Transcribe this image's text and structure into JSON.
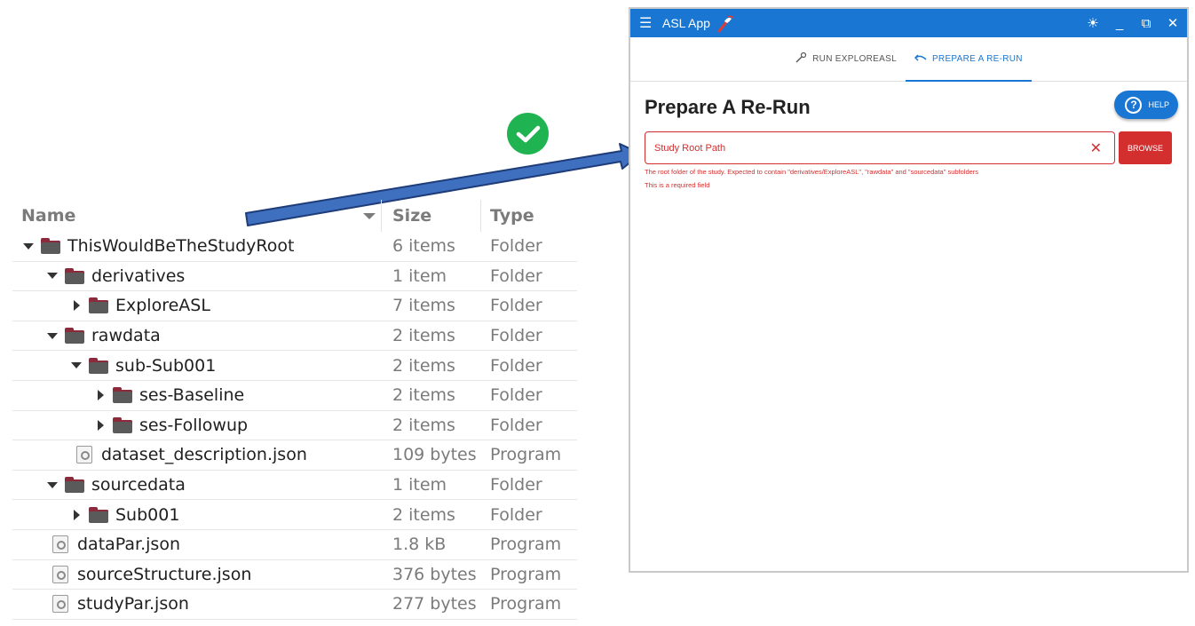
{
  "tree": {
    "header": {
      "name": "Name",
      "size": "Size",
      "type": "Type"
    },
    "rows": [
      {
        "name": "ThisWouldBeTheStudyRoot",
        "size": "6 items",
        "type": "Folder",
        "kind": "folder",
        "depth": 0,
        "expander": "down"
      },
      {
        "name": "derivatives",
        "size": "1 item",
        "type": "Folder",
        "kind": "folder",
        "depth": 1,
        "expander": "down"
      },
      {
        "name": "ExploreASL",
        "size": "7 items",
        "type": "Folder",
        "kind": "folder",
        "depth": 2,
        "expander": "right"
      },
      {
        "name": "rawdata",
        "size": "2 items",
        "type": "Folder",
        "kind": "folder",
        "depth": 1,
        "expander": "down"
      },
      {
        "name": "sub-Sub001",
        "size": "2 items",
        "type": "Folder",
        "kind": "folder",
        "depth": 2,
        "expander": "down"
      },
      {
        "name": "ses-Baseline",
        "size": "2 items",
        "type": "Folder",
        "kind": "folder",
        "depth": 3,
        "expander": "right"
      },
      {
        "name": "ses-Followup",
        "size": "2 items",
        "type": "Folder",
        "kind": "folder",
        "depth": 3,
        "expander": "right"
      },
      {
        "name": "dataset_description.json",
        "size": "109 bytes",
        "type": "Program",
        "kind": "file",
        "depth": 2,
        "expander": "none"
      },
      {
        "name": "sourcedata",
        "size": "1 item",
        "type": "Folder",
        "kind": "folder",
        "depth": 1,
        "expander": "down"
      },
      {
        "name": "Sub001",
        "size": "2 items",
        "type": "Folder",
        "kind": "folder",
        "depth": 2,
        "expander": "right"
      },
      {
        "name": "dataPar.json",
        "size": "1.8 kB",
        "type": "Program",
        "kind": "file",
        "depth": 1,
        "expander": "none"
      },
      {
        "name": "sourceStructure.json",
        "size": "376 bytes",
        "type": "Program",
        "kind": "file",
        "depth": 1,
        "expander": "none"
      },
      {
        "name": "studyPar.json",
        "size": "277 bytes",
        "type": "Program",
        "kind": "file",
        "depth": 1,
        "expander": "none"
      }
    ]
  },
  "app": {
    "title": "ASL App",
    "window_controls": {
      "theme": "☀",
      "minimize": "_",
      "maximize": "⧉",
      "close": "✕"
    },
    "tabs": [
      {
        "label": "RUN EXPLOREASL",
        "icon": "wrench-icon",
        "active": false
      },
      {
        "label": "PREPARE A RE-RUN",
        "icon": "undo-icon",
        "active": true
      }
    ],
    "page_title": "Prepare A Re-Run",
    "help_label": "HELP",
    "field": {
      "label": "Study Root Path",
      "helper": "The root folder of the study. Expected to contain \"derivatives/ExploreASL\", \"rawdata\" and \"sourcedata\" subfolders",
      "error": "This is a required field"
    },
    "browse_label": "BROWSE"
  },
  "colors": {
    "appbar": "#1976d2",
    "error": "#d32f2f",
    "check": "#1fb451",
    "arrow": "#3f6fbf"
  }
}
